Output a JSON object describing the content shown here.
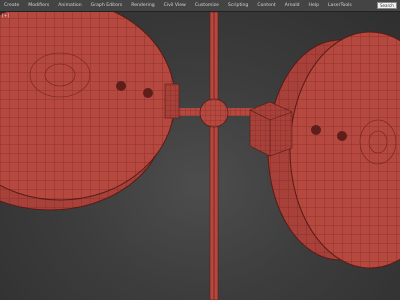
{
  "menubar": {
    "items": [
      "Create",
      "Modifiers",
      "Animation",
      "Graph Editors",
      "Rendering",
      "Civil View",
      "Customize",
      "Scripting",
      "Content",
      "Arnold",
      "Help",
      "LaserTools"
    ],
    "search_label": "Search"
  },
  "viewport": {
    "label": "[+]",
    "model_color": "#b5483f",
    "wire_color": "#6e211c"
  },
  "colors": {
    "menubar_bg": "#444444",
    "viewport_bg": "#3d3d3d"
  }
}
